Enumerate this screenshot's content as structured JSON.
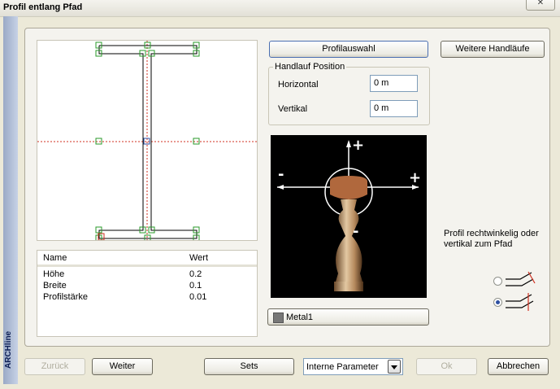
{
  "window": {
    "title": "Profil entlang Pfad",
    "close_label": "✕"
  },
  "sidebar": {
    "brand": "ARCHline"
  },
  "toolbar": {
    "profile_select_label": "Profilauswahl",
    "more_handrails_label": "Weitere Handläufe"
  },
  "handrail_position": {
    "title": "Handlauf Position",
    "horizontal_label": "Horizontal",
    "horizontal_value": "0 m",
    "vertical_label": "Vertikal",
    "vertical_value": "0 m"
  },
  "preview": {
    "minus_label": "-",
    "plus_label": "+"
  },
  "properties": {
    "headers": [
      "Name",
      "Wert"
    ],
    "rows": [
      {
        "name": "Höhe",
        "value": "0.2"
      },
      {
        "name": "Breite",
        "value": "0.1"
      },
      {
        "name": "Profilstärke",
        "value": "0.01"
      }
    ]
  },
  "orientation": {
    "label": "Profil rechtwinkelig oder vertikal zum Pfad",
    "options": [
      {
        "icon": "perpendicular-profile-icon",
        "checked": false
      },
      {
        "icon": "vertical-profile-icon",
        "checked": true
      }
    ]
  },
  "material": {
    "label": "Metal1",
    "swatch_color": "#777777"
  },
  "footer": {
    "back_label": "Zurück",
    "next_label": "Weiter",
    "sets_label": "Sets",
    "params_value": "Interne Parameter",
    "ok_label": "Ok",
    "cancel_label": "Abbrechen"
  },
  "colors": {
    "grid_guide": "#d03020",
    "handle": "#2a9a2a",
    "profile_outline": "#000000",
    "selection_blue": "#2d4fa1"
  }
}
